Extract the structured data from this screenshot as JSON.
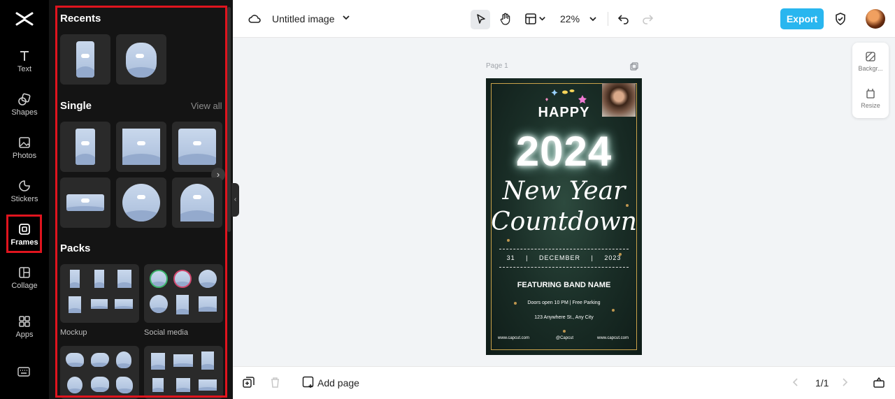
{
  "rail": {
    "items": [
      {
        "label": "Text",
        "icon": "text-icon"
      },
      {
        "label": "Shapes",
        "icon": "shapes-icon"
      },
      {
        "label": "Photos",
        "icon": "photos-icon"
      },
      {
        "label": "Stickers",
        "icon": "stickers-icon"
      },
      {
        "label": "Frames",
        "icon": "frames-icon",
        "active": true
      },
      {
        "label": "Collage",
        "icon": "collage-icon"
      },
      {
        "label": "Apps",
        "icon": "apps-icon"
      }
    ]
  },
  "panel": {
    "recents_title": "Recents",
    "single_title": "Single",
    "view_all": "View all",
    "packs_title": "Packs",
    "packs": [
      {
        "label": "Mockup"
      },
      {
        "label": "Social media"
      }
    ]
  },
  "topbar": {
    "title": "Untitled image",
    "zoom": "22%",
    "export_label": "Export"
  },
  "canvas": {
    "page_label": "Page 1",
    "poster": {
      "happy": "HAPPY",
      "year": "2024",
      "line1": "New Year",
      "line2": "Countdown",
      "date_day": "31",
      "date_month": "DECEMBER",
      "date_year": "2023",
      "date_sep": "|",
      "band": "FEATURING BAND NAME",
      "doors": "Doors open 10 PM | Free Parking",
      "address": "123 Anywhere St., Any City",
      "footer_left": "www.capcut.com",
      "footer_mid": "@Capcut",
      "footer_right": "www.capcut.com"
    }
  },
  "sidetools": {
    "background_label": "Backgr...",
    "resize_label": "Resize"
  },
  "bottombar": {
    "add_page_label": "Add page",
    "page_count": "1/1"
  },
  "colors": {
    "accent": "#29b6ef",
    "highlight": "#e0141e",
    "panel_bg": "#141414"
  }
}
